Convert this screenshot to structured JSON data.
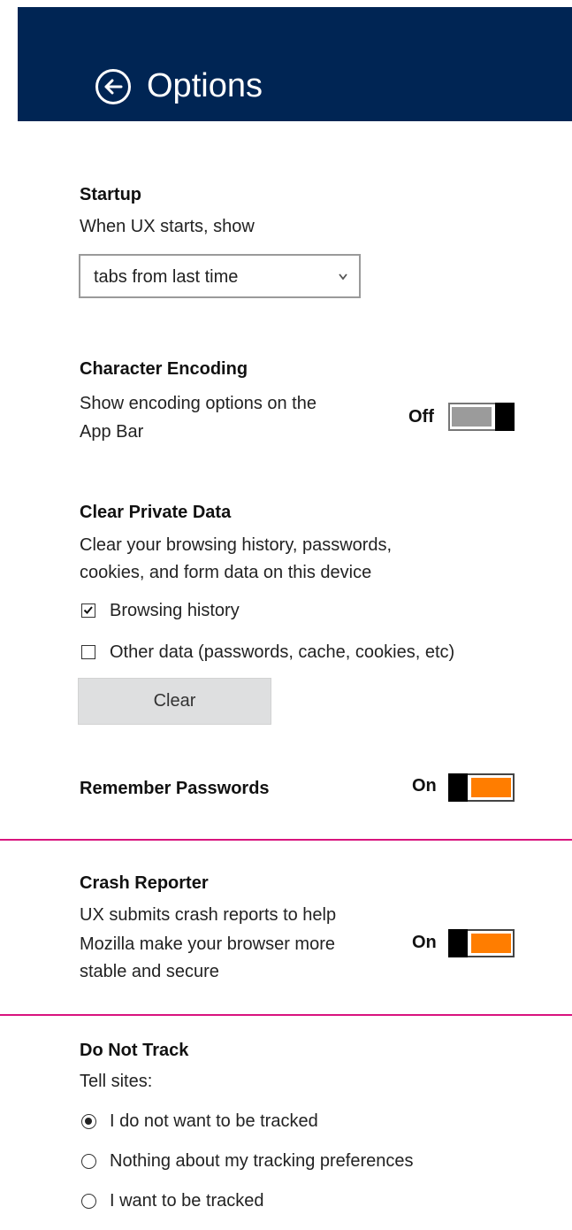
{
  "header": {
    "title": "Options",
    "back_icon": "arrow-left-circle-icon",
    "background": "#002554"
  },
  "startup": {
    "heading": "Startup",
    "description": "When UX starts, show",
    "select_value": "tabs from last time"
  },
  "encoding": {
    "heading": "Character Encoding",
    "description_line1": "Show encoding options on the",
    "description_line2": "App Bar",
    "toggle_label": "Off",
    "toggle_on": false
  },
  "private_data": {
    "heading": "Clear Private Data",
    "description_line1": "Clear your browsing history, passwords,",
    "description_line2": "cookies, and form data on this device",
    "options": [
      {
        "label": "Browsing history",
        "checked": true
      },
      {
        "label": "Other data (passwords, cache, cookies, etc)",
        "checked": false
      }
    ],
    "clear_label": "Clear"
  },
  "passwords": {
    "heading": "Remember Passwords",
    "toggle_label": "On",
    "toggle_on": true
  },
  "crash": {
    "heading": "Crash Reporter",
    "description_line1": "UX submits crash reports to help",
    "description_line2": "Mozilla make your browser more",
    "description_line3": "stable and secure",
    "toggle_label": "On",
    "toggle_on": true
  },
  "dnt": {
    "heading": "Do Not Track",
    "description": "Tell sites:",
    "options": [
      {
        "label": "I do not want to be tracked",
        "selected": true
      },
      {
        "label": "Nothing about my tracking preferences",
        "selected": false
      },
      {
        "label": "I want to be tracked",
        "selected": false
      }
    ]
  },
  "colors": {
    "accent_on": "#ff7d00",
    "divider": "#d9147e",
    "toggle_off": "#9b9b9b"
  }
}
